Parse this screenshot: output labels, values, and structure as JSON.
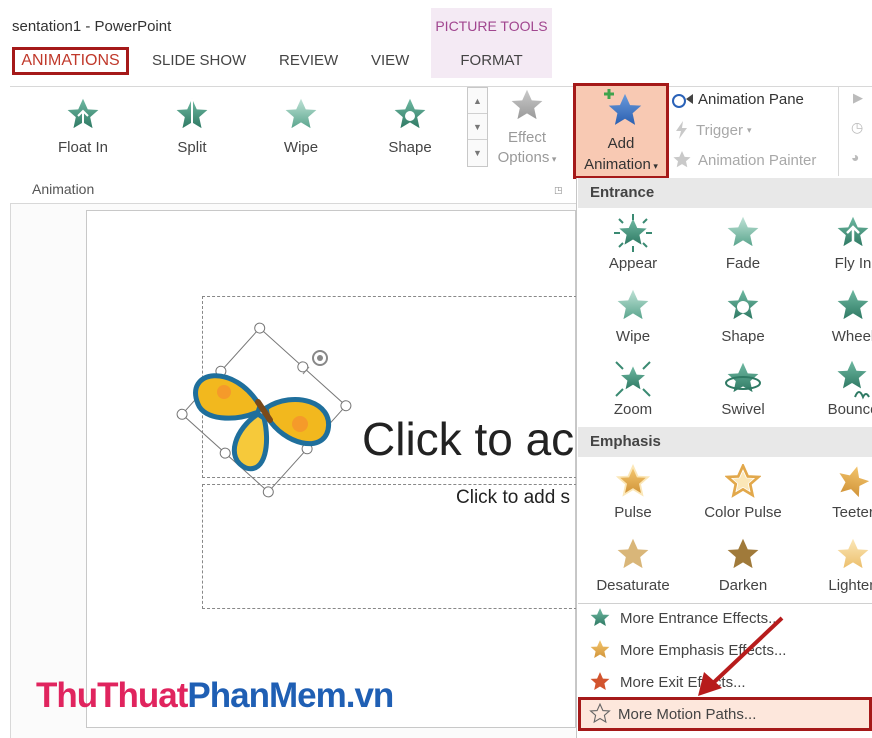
{
  "window": {
    "title": "sentation1 - PowerPoint"
  },
  "contextual_tab": {
    "group_label": "PICTURE TOOLS",
    "tab": "FORMAT"
  },
  "tabs": [
    "ANIMATIONS",
    "SLIDE SHOW",
    "REVIEW",
    "VIEW"
  ],
  "ribbon": {
    "gallery": [
      {
        "label": "Float In",
        "icon": "float-in-star-icon"
      },
      {
        "label": "Split",
        "icon": "split-star-icon"
      },
      {
        "label": "Wipe",
        "icon": "wipe-star-icon"
      },
      {
        "label": "Shape",
        "icon": "shape-star-icon"
      }
    ],
    "effect_options": {
      "line1": "Effect",
      "line2": "Options"
    },
    "add_animation": {
      "line1": "Add",
      "line2": "Animation"
    },
    "advanced": {
      "animation_pane": "Animation Pane",
      "trigger": "Trigger",
      "animation_painter": "Animation Painter"
    },
    "group_label": "Animation",
    "colors": {
      "entrance_star": "#4e9c84",
      "emphasis_star": "#e2a84b",
      "selected_tab": "#c0392b",
      "highlight_border": "#a51919"
    }
  },
  "slide": {
    "title_placeholder": "Click to ac",
    "subtitle_placeholder": "Click to add s"
  },
  "dropdown": {
    "entrance": {
      "header": "Entrance",
      "items": [
        "Appear",
        "Fade",
        "Fly In",
        "Wipe",
        "Shape",
        "Wheel",
        "Zoom",
        "Swivel",
        "Bounce"
      ]
    },
    "emphasis": {
      "header": "Emphasis",
      "items": [
        "Pulse",
        "Color Pulse",
        "Teeter",
        "Desaturate",
        "Darken",
        "Lighten"
      ]
    },
    "more": {
      "entrance": "More Entrance Effects...",
      "emphasis": "More Emphasis Effects...",
      "exit": "More Exit Effects...",
      "motion": "More Motion Paths..."
    }
  },
  "watermark": {
    "part1": "ThuThuat",
    "part2": "PhanMem",
    "part3": ".vn"
  }
}
